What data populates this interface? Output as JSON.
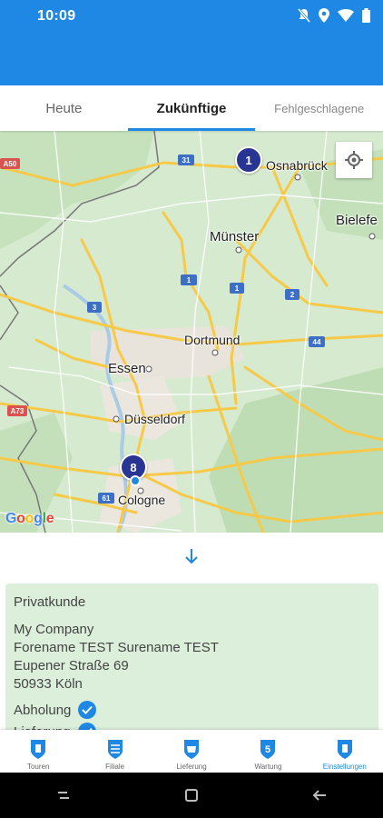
{
  "status_bar": {
    "time": "10:09",
    "icons": [
      "mute-icon",
      "location-icon",
      "wifi-icon",
      "battery-icon"
    ]
  },
  "tabs": [
    {
      "label": "Heute",
      "active": false
    },
    {
      "label": "Zukünftige",
      "active": true
    },
    {
      "label": "Fehlgeschlagene",
      "active": false
    }
  ],
  "map": {
    "cities": {
      "osnabrueck": "Osnabrück",
      "muenster": "Münster",
      "bielefeld": "Bielefe",
      "dortmund": "Dortmund",
      "essen": "Essen",
      "duesseldorf": "Düsseldorf",
      "cologne": "Cologne"
    },
    "roads": {
      "a50": "A50",
      "r31": "31",
      "r1": "1",
      "r2": "2",
      "r3": "3",
      "r44": "44",
      "a73": "A73",
      "r61": "61"
    },
    "markers": [
      {
        "label": "1"
      },
      {
        "label": "8"
      }
    ],
    "attribution": "Google"
  },
  "card": {
    "type": "Privatkunde",
    "company": "My Company",
    "name": "Forename TEST Surename TEST",
    "street": "Eupener Straße 69",
    "city": "50933 Köln",
    "services": [
      {
        "label": "Abholung",
        "checked": true
      },
      {
        "label": "Lieferung",
        "checked": true
      }
    ]
  },
  "bottom_nav": [
    {
      "label": "Touren",
      "icon": "route-icon",
      "active": false
    },
    {
      "label": "Filiale",
      "icon": "store-icon",
      "active": false
    },
    {
      "label": "Lieferung",
      "icon": "delivery-icon",
      "active": false
    },
    {
      "label": "Wartung",
      "icon": "maintenance-icon",
      "active": false
    },
    {
      "label": "Einstellungen",
      "icon": "settings-icon",
      "active": true
    }
  ],
  "colors": {
    "primary": "#1f88e5",
    "card_bg": "#dcefdb",
    "marker": "#283593"
  }
}
